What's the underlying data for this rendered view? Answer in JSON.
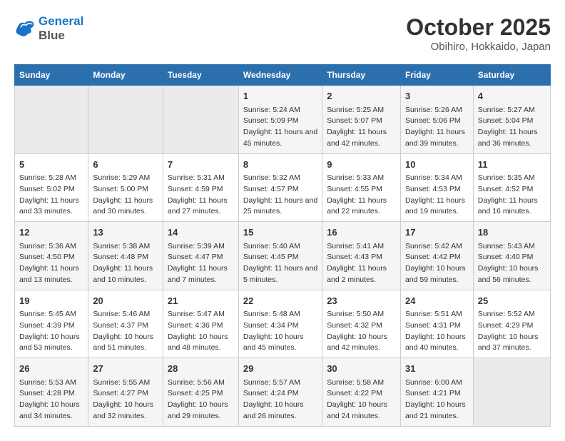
{
  "header": {
    "logo_line1": "General",
    "logo_line2": "Blue",
    "month": "October 2025",
    "location": "Obihiro, Hokkaido, Japan"
  },
  "weekdays": [
    "Sunday",
    "Monday",
    "Tuesday",
    "Wednesday",
    "Thursday",
    "Friday",
    "Saturday"
  ],
  "weeks": [
    [
      {
        "day": "",
        "empty": true
      },
      {
        "day": "",
        "empty": true
      },
      {
        "day": "",
        "empty": true
      },
      {
        "day": "1",
        "sunrise": "5:24 AM",
        "sunset": "5:09 PM",
        "daylight": "11 hours and 45 minutes."
      },
      {
        "day": "2",
        "sunrise": "5:25 AM",
        "sunset": "5:07 PM",
        "daylight": "11 hours and 42 minutes."
      },
      {
        "day": "3",
        "sunrise": "5:26 AM",
        "sunset": "5:06 PM",
        "daylight": "11 hours and 39 minutes."
      },
      {
        "day": "4",
        "sunrise": "5:27 AM",
        "sunset": "5:04 PM",
        "daylight": "11 hours and 36 minutes."
      }
    ],
    [
      {
        "day": "5",
        "sunrise": "5:28 AM",
        "sunset": "5:02 PM",
        "daylight": "11 hours and 33 minutes."
      },
      {
        "day": "6",
        "sunrise": "5:29 AM",
        "sunset": "5:00 PM",
        "daylight": "11 hours and 30 minutes."
      },
      {
        "day": "7",
        "sunrise": "5:31 AM",
        "sunset": "4:59 PM",
        "daylight": "11 hours and 27 minutes."
      },
      {
        "day": "8",
        "sunrise": "5:32 AM",
        "sunset": "4:57 PM",
        "daylight": "11 hours and 25 minutes."
      },
      {
        "day": "9",
        "sunrise": "5:33 AM",
        "sunset": "4:55 PM",
        "daylight": "11 hours and 22 minutes."
      },
      {
        "day": "10",
        "sunrise": "5:34 AM",
        "sunset": "4:53 PM",
        "daylight": "11 hours and 19 minutes."
      },
      {
        "day": "11",
        "sunrise": "5:35 AM",
        "sunset": "4:52 PM",
        "daylight": "11 hours and 16 minutes."
      }
    ],
    [
      {
        "day": "12",
        "sunrise": "5:36 AM",
        "sunset": "4:50 PM",
        "daylight": "11 hours and 13 minutes."
      },
      {
        "day": "13",
        "sunrise": "5:38 AM",
        "sunset": "4:48 PM",
        "daylight": "11 hours and 10 minutes."
      },
      {
        "day": "14",
        "sunrise": "5:39 AM",
        "sunset": "4:47 PM",
        "daylight": "11 hours and 7 minutes."
      },
      {
        "day": "15",
        "sunrise": "5:40 AM",
        "sunset": "4:45 PM",
        "daylight": "11 hours and 5 minutes."
      },
      {
        "day": "16",
        "sunrise": "5:41 AM",
        "sunset": "4:43 PM",
        "daylight": "11 hours and 2 minutes."
      },
      {
        "day": "17",
        "sunrise": "5:42 AM",
        "sunset": "4:42 PM",
        "daylight": "10 hours and 59 minutes."
      },
      {
        "day": "18",
        "sunrise": "5:43 AM",
        "sunset": "4:40 PM",
        "daylight": "10 hours and 56 minutes."
      }
    ],
    [
      {
        "day": "19",
        "sunrise": "5:45 AM",
        "sunset": "4:39 PM",
        "daylight": "10 hours and 53 minutes."
      },
      {
        "day": "20",
        "sunrise": "5:46 AM",
        "sunset": "4:37 PM",
        "daylight": "10 hours and 51 minutes."
      },
      {
        "day": "21",
        "sunrise": "5:47 AM",
        "sunset": "4:36 PM",
        "daylight": "10 hours and 48 minutes."
      },
      {
        "day": "22",
        "sunrise": "5:48 AM",
        "sunset": "4:34 PM",
        "daylight": "10 hours and 45 minutes."
      },
      {
        "day": "23",
        "sunrise": "5:50 AM",
        "sunset": "4:32 PM",
        "daylight": "10 hours and 42 minutes."
      },
      {
        "day": "24",
        "sunrise": "5:51 AM",
        "sunset": "4:31 PM",
        "daylight": "10 hours and 40 minutes."
      },
      {
        "day": "25",
        "sunrise": "5:52 AM",
        "sunset": "4:29 PM",
        "daylight": "10 hours and 37 minutes."
      }
    ],
    [
      {
        "day": "26",
        "sunrise": "5:53 AM",
        "sunset": "4:28 PM",
        "daylight": "10 hours and 34 minutes."
      },
      {
        "day": "27",
        "sunrise": "5:55 AM",
        "sunset": "4:27 PM",
        "daylight": "10 hours and 32 minutes."
      },
      {
        "day": "28",
        "sunrise": "5:56 AM",
        "sunset": "4:25 PM",
        "daylight": "10 hours and 29 minutes."
      },
      {
        "day": "29",
        "sunrise": "5:57 AM",
        "sunset": "4:24 PM",
        "daylight": "10 hours and 26 minutes."
      },
      {
        "day": "30",
        "sunrise": "5:58 AM",
        "sunset": "4:22 PM",
        "daylight": "10 hours and 24 minutes."
      },
      {
        "day": "31",
        "sunrise": "6:00 AM",
        "sunset": "4:21 PM",
        "daylight": "10 hours and 21 minutes."
      },
      {
        "day": "",
        "empty": true
      }
    ]
  ]
}
